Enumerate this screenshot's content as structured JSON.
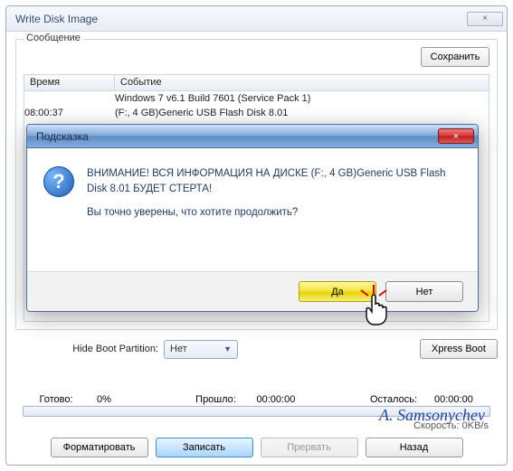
{
  "window": {
    "title": "Write Disk Image",
    "close_glyph": "×"
  },
  "log": {
    "group_label": "Сообщение",
    "save_btn": "Сохранить",
    "headers": {
      "time": "Время",
      "event": "Событие"
    },
    "rows": [
      {
        "time": "",
        "event": "Windows 7 v6.1 Build 7601 (Service Pack 1)"
      },
      {
        "time": "08:00:37",
        "event": "(F:, 4 GB)Generic USB Flash Disk  8.01"
      }
    ]
  },
  "form": {
    "disk_drive_label": "",
    "hide_boot_label": "Hide Boot Partition:",
    "hide_boot_value": "Нет",
    "xpress_btn": "Xpress Boot"
  },
  "progress": {
    "ready_label": "Готово:",
    "ready_value": "0%",
    "elapsed_label": "Прошло:",
    "elapsed_value": "00:00:00",
    "remain_label": "Осталось:",
    "remain_value": "00:00:00",
    "speed_label": "Скорость:",
    "speed_value": "0KB/s"
  },
  "buttons": {
    "format": "Форматировать",
    "write": "Записать",
    "abort": "Прервать",
    "back": "Назад"
  },
  "dialog": {
    "title": "Подсказка",
    "close_glyph": "×",
    "warn": "ВНИМАНИЕ! ВСЯ ИНФОРМАЦИЯ НА ДИСКЕ (F:, 4 GB)Generic USB Flash Disk 8.01 БУДЕТ СТЕРТА!",
    "confirm": "Вы точно уверены, что хотите продолжить?",
    "yes": "Да",
    "no": "Нет",
    "icon_glyph": "?"
  },
  "watermark": "A. Samsonychev"
}
